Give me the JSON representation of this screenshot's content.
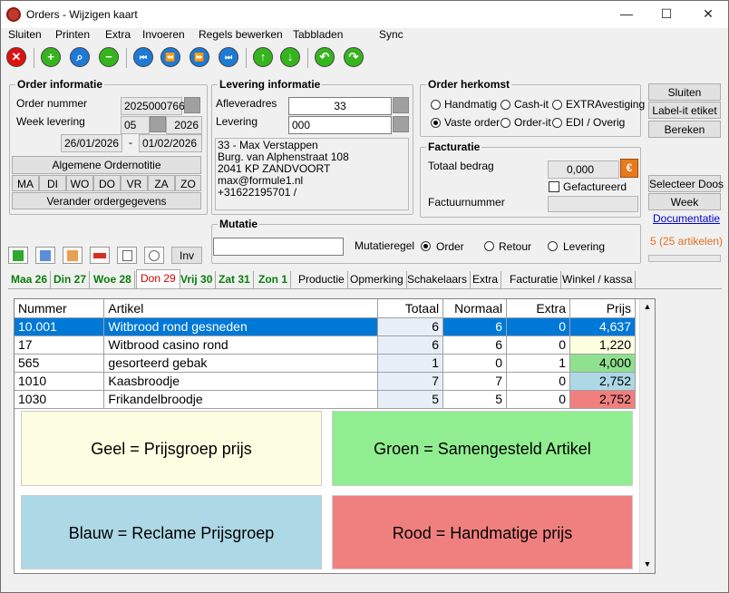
{
  "window": {
    "title": "Orders - Wijzigen kaart",
    "minimize": "—",
    "maximize": "☐",
    "close": "✕"
  },
  "menu": [
    "Sluiten",
    "Printen",
    "Extra",
    "Invoeren",
    "Regels bewerken",
    "Tabbladen",
    "Sync"
  ],
  "toolbar": {
    "cancel": "✕",
    "add": "+",
    "search": "⌕",
    "remove": "−",
    "first": "⏮",
    "prev": "⏪",
    "next": "⏩",
    "last": "⏭",
    "up": "↑",
    "down": "↓",
    "undo": "↶",
    "redo": "↷"
  },
  "order_info": {
    "title": "Order informatie",
    "order_number_label": "Order nummer",
    "order_number": "2025000766",
    "week_label": "Week levering",
    "week": "05",
    "year": "2026",
    "date_from": "26/01/2026",
    "dash": "-",
    "date_to": "01/02/2026",
    "general_btn": "Algemene Ordernotitie",
    "days": [
      "MA",
      "DI",
      "WO",
      "DO",
      "VR",
      "ZA",
      "ZO"
    ],
    "change_btn": "Verander ordergegevens"
  },
  "delivery_info": {
    "title": "Levering informatie",
    "address_label": "Afleveradres",
    "address": "33",
    "delivery_label": "Levering",
    "delivery": "000",
    "lines": [
      "33 - Max Verstappen",
      "Burg. van Alphenstraat 108",
      "2041 KP ZANDVOORT",
      "max@formule1.nl",
      "+31622195701 /"
    ]
  },
  "origin": {
    "title": "Order herkomst",
    "options": [
      "Handmatig",
      "Cash-it",
      "EXTRAvestiging",
      "Vaste order",
      "Order-it",
      "EDI / Overig"
    ]
  },
  "invoice": {
    "title": "Facturatie",
    "total_label": "Totaal bedrag",
    "total": "0,000",
    "currency": "€",
    "invoiced": "Gefactureerd",
    "number_label": "Factuurnummer"
  },
  "right": {
    "close": "Sluiten",
    "label": "Label-it etiket",
    "calc": "Bereken",
    "select_box": "Selecteer Doos",
    "week": "Week",
    "docs": "Documentatie",
    "count": "5 (25 artikelen)"
  },
  "mutation": {
    "title": "Mutatie",
    "rule_label": "Mutatieregel",
    "options": [
      "Order",
      "Retour",
      "Levering"
    ]
  },
  "inv": "Inv",
  "tabs": [
    {
      "label": "Maa 26",
      "color": "#0a7d0a"
    },
    {
      "label": "Din 27",
      "color": "#0a7d0a"
    },
    {
      "label": "Woe 28",
      "color": "#0a7d0a"
    },
    {
      "label": "Don 29",
      "color": "#d00000"
    },
    {
      "label": "Vrij 30",
      "color": "#0a7d0a"
    },
    {
      "label": "Zat 31",
      "color": "#0a7d0a"
    },
    {
      "label": "Zon 1",
      "color": "#0a7d0a"
    },
    {
      "label": "Productie",
      "color": "#000"
    },
    {
      "label": "Opmerking",
      "color": "#000"
    },
    {
      "label": "Schakelaars",
      "color": "#000"
    },
    {
      "label": "Extra",
      "color": "#000"
    },
    {
      "label": "Facturatie",
      "color": "#000"
    },
    {
      "label": "Winkel / kassa",
      "color": "#000"
    }
  ],
  "grid": {
    "headers": [
      "Nummer",
      "Artikel",
      "Totaal",
      "Normaal",
      "Extra",
      "Prijs"
    ],
    "rows": [
      {
        "nummer": "10.001",
        "artikel": "Witbrood rond gesneden",
        "totaal": "6",
        "normaal": "6",
        "extra": "0",
        "prijs": "4,637",
        "color": "#0078d7"
      },
      {
        "nummer": "17",
        "artikel": "Witbrood casino rond",
        "totaal": "6",
        "normaal": "6",
        "extra": "0",
        "prijs": "1,220",
        "color": "#fdfde0"
      },
      {
        "nummer": "565",
        "artikel": "gesorteerd gebak",
        "totaal": "1",
        "normaal": "0",
        "extra": "1",
        "prijs": "4,000",
        "color": "#8fe08f"
      },
      {
        "nummer": "1010",
        "artikel": "Kaasbroodje",
        "totaal": "7",
        "normaal": "7",
        "extra": "0",
        "prijs": "2,752",
        "color": "#add8e6"
      },
      {
        "nummer": "1030",
        "artikel": "Frikandelbroodje",
        "totaal": "5",
        "normaal": "5",
        "extra": "0",
        "prijs": "2,752",
        "color": "#f08080"
      }
    ]
  },
  "legend": [
    {
      "text": "Geel = Prijsgroep prijs",
      "color": "#fefee2"
    },
    {
      "text": "Groen = Samengesteld Artikel",
      "color": "#90ee90"
    },
    {
      "text": "Blauw = Reclame Prijsgroep",
      "color": "#add8e6"
    },
    {
      "text": "Rood = Handmatige prijs",
      "color": "#f08080"
    }
  ]
}
